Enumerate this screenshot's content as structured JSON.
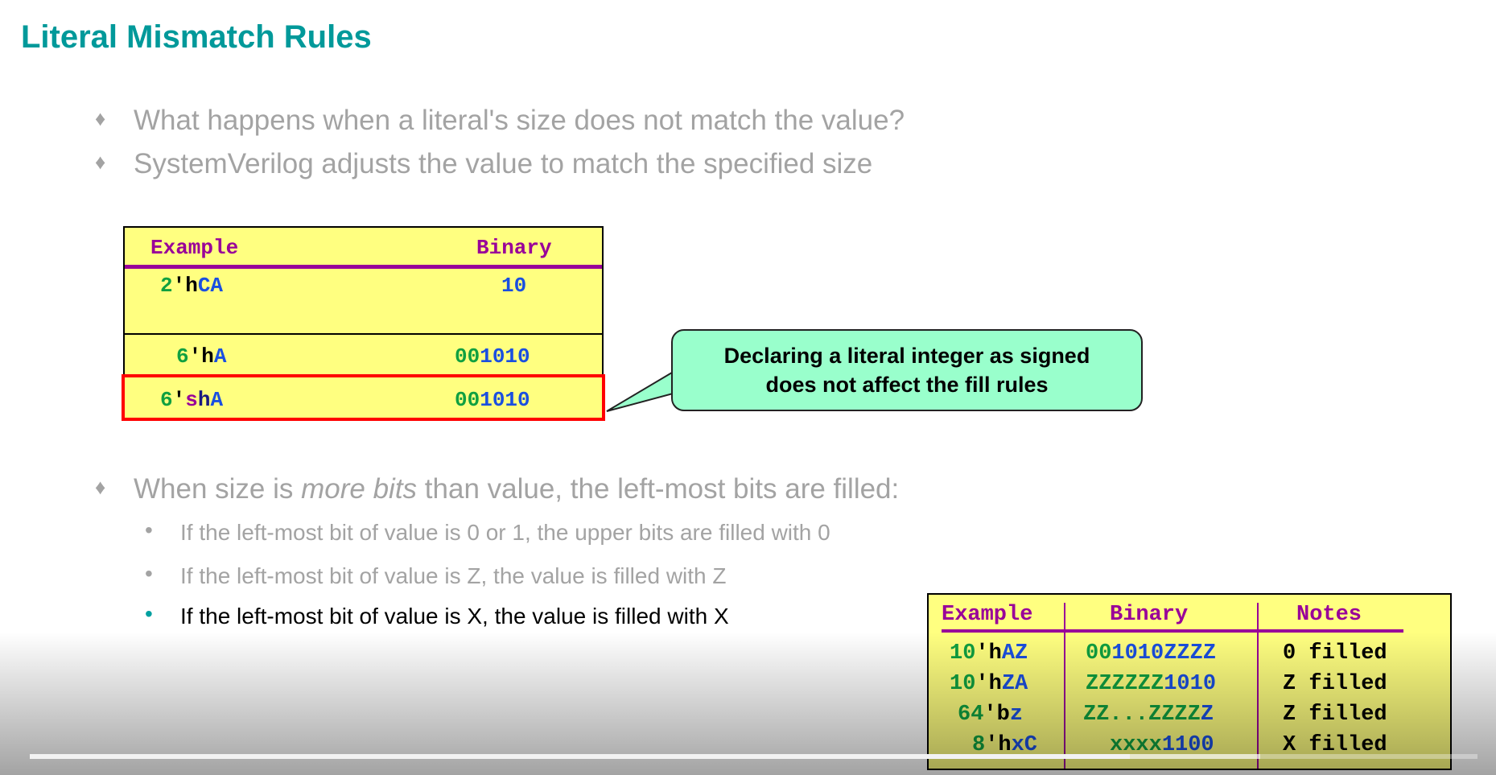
{
  "title": "Literal Mismatch Rules",
  "bullets": [
    "What happens when a literal's size does not match the value?",
    "SystemVerilog adjusts the value to match the specified size",
    {
      "pre": "When size is ",
      "em": "more bits",
      "post": " than value, the left-most bits are filled:"
    }
  ],
  "sub_bullets": [
    "If the left-most bit of value is 0 or 1, the upper bits are filled with 0",
    "If the left-most bit of value is Z, the value is filled with Z",
    "If the left-most bit of value is X, the value is filled with X"
  ],
  "table1": {
    "headers": [
      "Example",
      "Binary"
    ],
    "rows": [
      {
        "example": [
          "2",
          "'h",
          "CA"
        ],
        "binary": [
          "",
          "10"
        ]
      },
      {
        "example": [
          "6",
          "'h",
          "A"
        ],
        "binary": [
          "00",
          "1010"
        ]
      },
      {
        "example": [
          "6",
          "'",
          "s",
          "h",
          "A"
        ],
        "binary": [
          "00",
          "1010"
        ]
      }
    ]
  },
  "callout": {
    "line1": "Declaring a literal integer as signed",
    "line2": "does not affect the fill rules"
  },
  "table2": {
    "headers": [
      "Example",
      "Binary",
      "Notes"
    ],
    "rows": [
      {
        "example": [
          "10",
          "'h",
          "AZ"
        ],
        "binary": [
          "00",
          "1010ZZZZ"
        ],
        "notes": "0 filled"
      },
      {
        "example": [
          "10",
          "'h",
          "ZA"
        ],
        "binary": [
          "ZZZZZZ",
          "1010"
        ],
        "notes": "Z filled"
      },
      {
        "example": [
          "64",
          "'b",
          "z"
        ],
        "binary": [
          "ZZ...ZZZZ",
          "Z"
        ],
        "notes": "Z filled"
      },
      {
        "example": [
          "8",
          "'h",
          "xC"
        ],
        "binary": [
          "xxxx",
          "1100"
        ],
        "notes": "X filled"
      }
    ]
  },
  "video_progress": {
    "played_fraction": 0.76,
    "loaded_fraction": 0.85
  },
  "colors": {
    "title": "#00999a",
    "header": "#990099",
    "green": "#10a040",
    "blue": "#1a4fe0",
    "callout": "#99ffcc",
    "table": "#ffff80"
  }
}
